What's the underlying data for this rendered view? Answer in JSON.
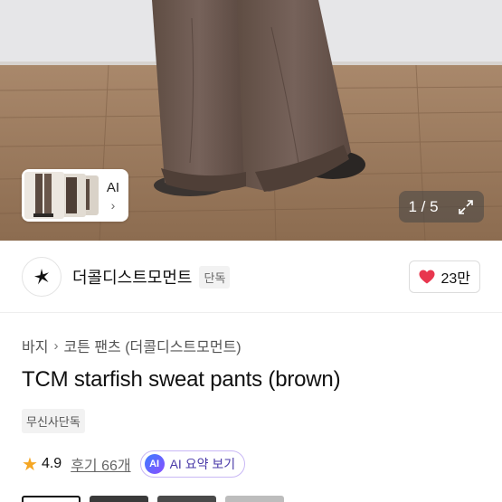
{
  "gallery": {
    "thumb_ai_label": "AI",
    "counter": "1 / 5"
  },
  "brand": {
    "name": "더콜디스트모먼트",
    "badge": "단독",
    "likes": "23만"
  },
  "breadcrumb": {
    "category": "바지",
    "subcategory": "코튼 팬츠 (더콜디스트모먼트)"
  },
  "product": {
    "title": "TCM starfish sweat pants (brown)",
    "exclusive_tag": "무신사단독"
  },
  "rating": {
    "score": "4.9",
    "reviews": "후기 66개",
    "ai_summary_icon": "AI",
    "ai_summary_label": "AI 요약 보기"
  },
  "colors": {
    "heart": "#e8364e",
    "star": "#f5a623",
    "ai_gradient_start": "#3d7dff",
    "ai_gradient_end": "#8a4dff",
    "pants_brown": "#6e5a4f"
  }
}
